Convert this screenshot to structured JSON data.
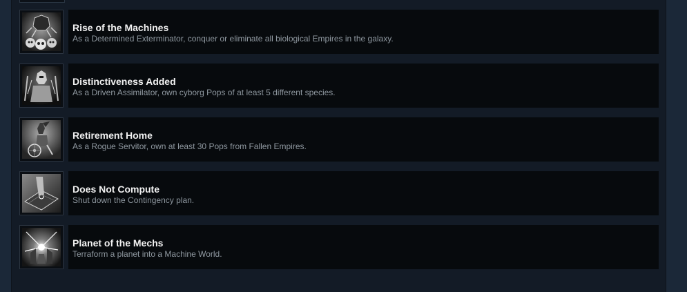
{
  "achievements": [
    {
      "title": "Rise of the Machines",
      "description": "As a Determined Exterminator, conquer or eliminate all biological Empires in the galaxy.",
      "icon": "skulls-robot-icon"
    },
    {
      "title": "Distinctiveness Added",
      "description": "As a Driven Assimilator, own cyborg Pops of at least 5 different species.",
      "icon": "cyborg-figure-icon"
    },
    {
      "title": "Retirement Home",
      "description": "As a Rogue Servitor, own at least 30 Pops from Fallen Empires.",
      "icon": "wheelchair-alien-icon"
    },
    {
      "title": "Does Not Compute",
      "description": "Shut down the Contingency plan.",
      "icon": "shutdown-switch-icon"
    },
    {
      "title": "Planet of the Mechs",
      "description": "Terraform a planet into a Machine World.",
      "icon": "machine-world-icon"
    }
  ]
}
